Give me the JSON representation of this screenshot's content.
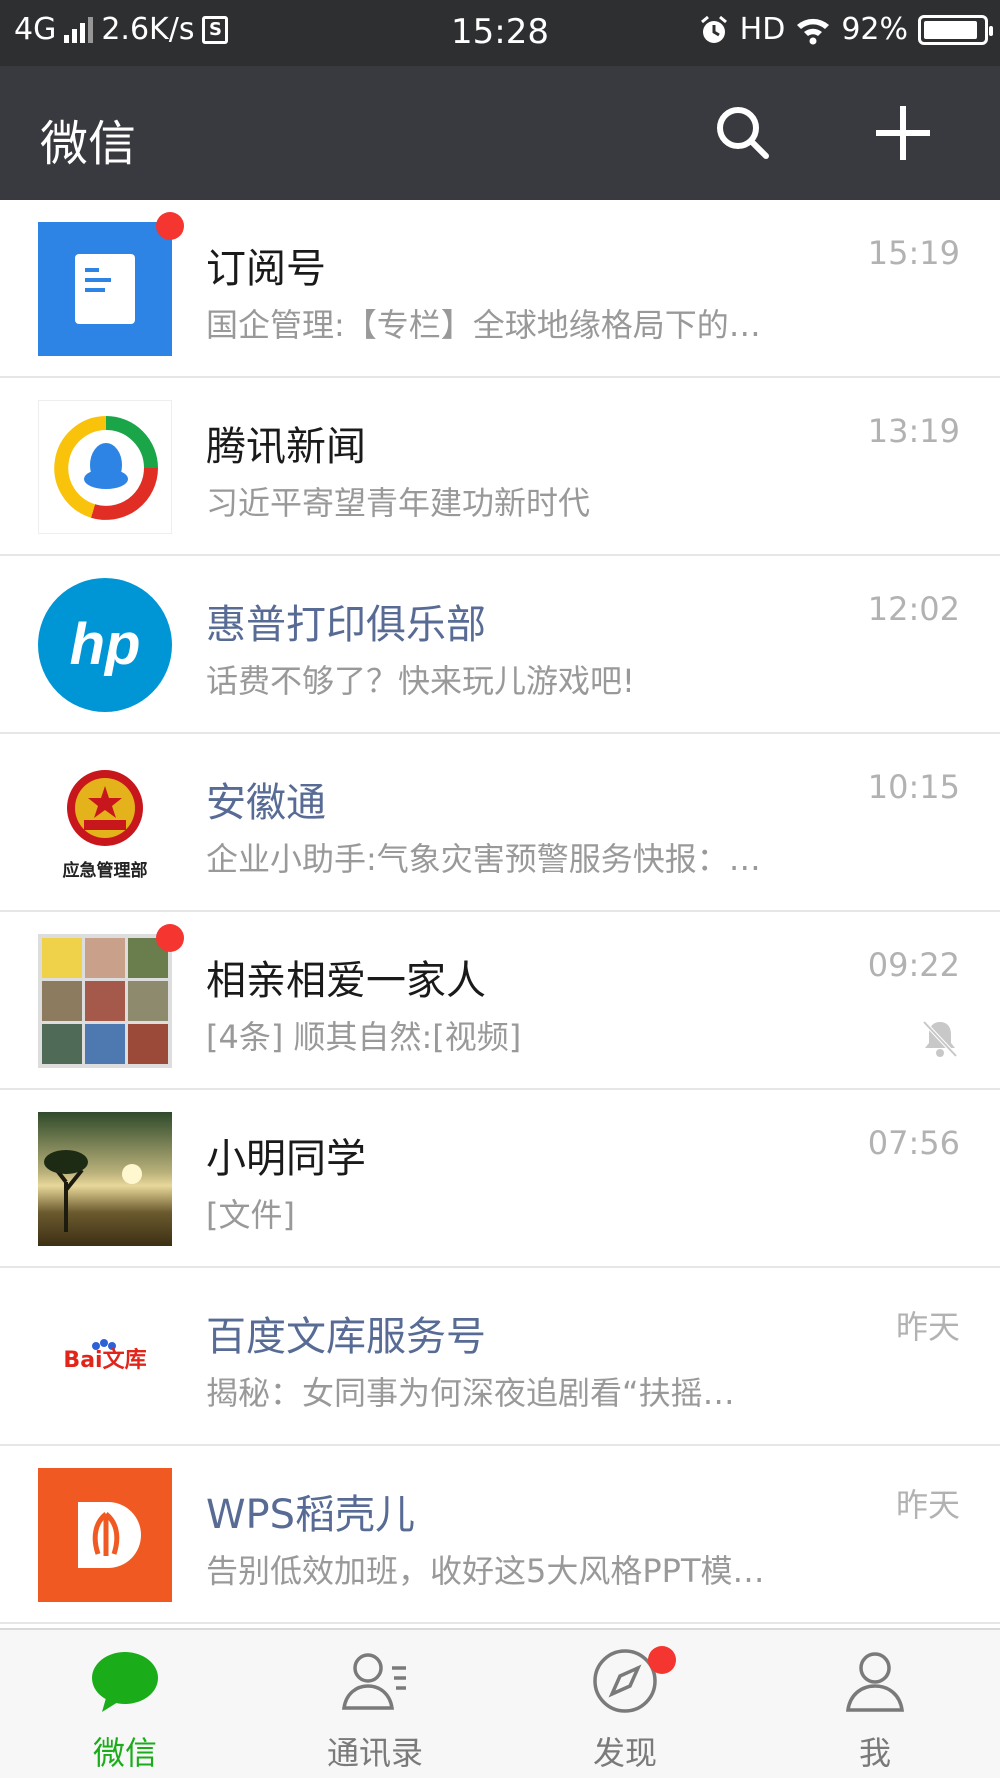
{
  "status_bar": {
    "network": "4G",
    "speed": "2.6K/s",
    "sim_badge": "S",
    "time": "15:28",
    "hd": "HD",
    "battery": "92%",
    "battery_level": 0.92
  },
  "header": {
    "title": "微信",
    "icons": [
      "search-icon",
      "plus-icon"
    ]
  },
  "chats": [
    {
      "name": "订阅号",
      "preview": "国企管理:【专栏】全球地缘格局下的…",
      "time": "15:19",
      "avatar": "subscription-icon",
      "unread_dot": true,
      "name_style": "normal"
    },
    {
      "name": "腾讯新闻",
      "preview": "习近平寄望青年建功新时代",
      "time": "13:19",
      "avatar": "tencent-news-logo",
      "unread_dot": false,
      "name_style": "normal"
    },
    {
      "name": "惠普打印俱乐部",
      "preview": "话费不够了？快来玩儿游戏吧!",
      "time": "12:02",
      "avatar": "hp-logo",
      "unread_dot": false,
      "name_style": "blue"
    },
    {
      "name": "安徽通",
      "preview": "企业小助手:气象灾害预警服务快报：…",
      "time": "10:15",
      "avatar": "emergency-management-emblem",
      "avatar_caption": "应急管理部",
      "unread_dot": false,
      "name_style": "blue"
    },
    {
      "name": "相亲相爱一家人",
      "preview": "[4条] 顺其自然:[视频]",
      "time": "09:22",
      "avatar": "group-photo-grid",
      "unread_dot": true,
      "muted": true,
      "name_style": "normal"
    },
    {
      "name": "小明同学",
      "preview": "[文件]",
      "time": "07:56",
      "avatar": "sunset-photo",
      "unread_dot": false,
      "name_style": "normal"
    },
    {
      "name": "百度文库服务号",
      "preview": "揭秘：女同事为何深夜追剧看“扶摇…",
      "time": "昨天",
      "avatar": "baidu-wenku-logo",
      "avatar_caption": "Bai文库",
      "unread_dot": false,
      "name_style": "blue"
    },
    {
      "name": "WPS稻壳儿",
      "preview": "告别低效加班，收好这5大风格PPT模…",
      "time": "昨天",
      "avatar": "wps-docer-logo",
      "unread_dot": false,
      "name_style": "blue"
    }
  ],
  "tabs": [
    {
      "label": "微信",
      "icon": "chat-bubble-icon",
      "active": true
    },
    {
      "label": "通讯录",
      "icon": "contacts-icon",
      "active": false
    },
    {
      "label": "发现",
      "icon": "compass-icon",
      "active": false,
      "dot": true
    },
    {
      "label": "我",
      "icon": "profile-icon",
      "active": false
    }
  ],
  "colors": {
    "header_bg": "#393a3f",
    "status_bg": "#2e2f31",
    "accent_green": "#1aad19",
    "unread_red": "#f43530",
    "official_name_blue": "#576b95"
  }
}
